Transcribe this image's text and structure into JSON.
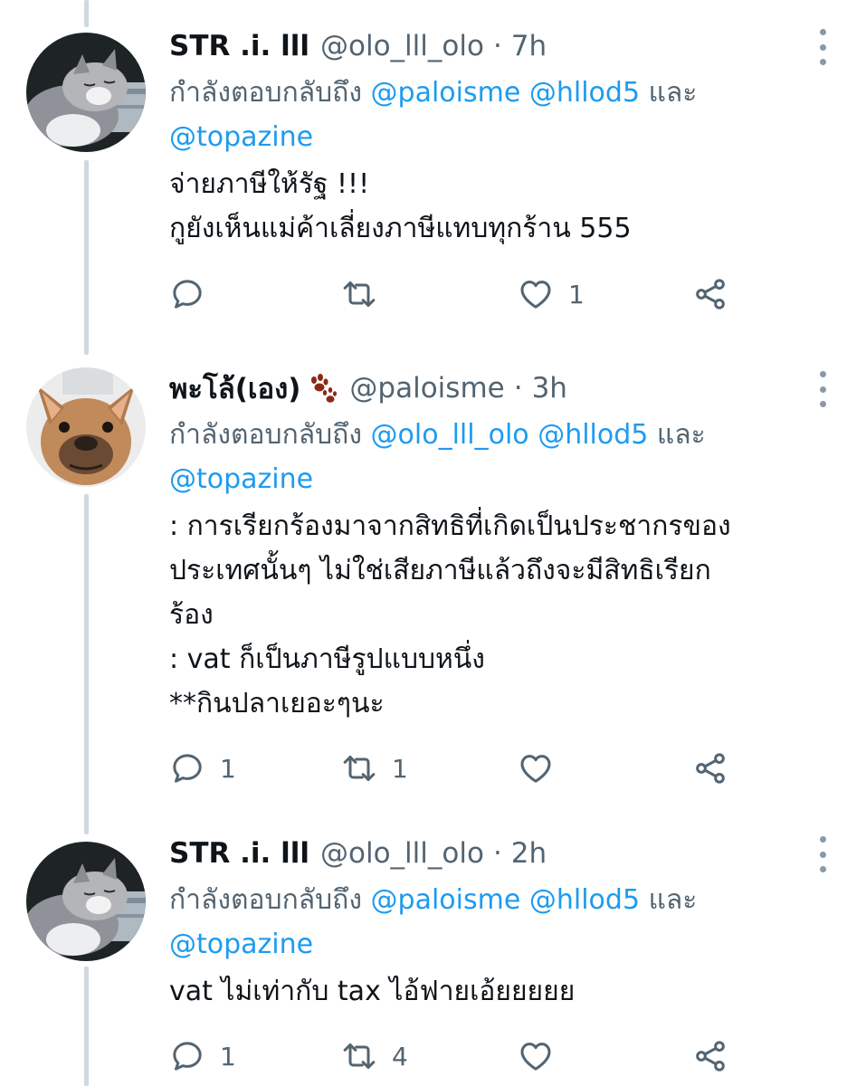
{
  "reply_prefix": "กำลังตอบกลับถึง",
  "and_word": "และ",
  "tweets": [
    {
      "name": "STR .i. lll",
      "handle": "@olo_lll_olo",
      "time": "7h",
      "mentions": [
        "@paloisme",
        "@hllod5",
        "@topazine"
      ],
      "lines": [
        "จ่ายภาษีให้รัฐ !!!",
        "กูยังเห็นแม่ค้าเลี่ยงภาษีแทบทุกร้าน 555"
      ],
      "replies": "",
      "retweets": "",
      "likes": "1"
    },
    {
      "name": "พะโล้(เอง)",
      "name_emoji": "paw-prints-icon",
      "handle": "@paloisme",
      "time": "3h",
      "mentions": [
        "@olo_lll_olo",
        "@hllod5",
        "@topazine"
      ],
      "lines": [
        ": การเรียกร้องมาจากสิทธิที่เกิดเป็นประชากรของ",
        "ประเทศนั้นๆ ไม่ใช่เสียภาษีแล้วถึงจะมีสิทธิเรียก",
        "ร้อง",
        ": vat ก็เป็นภาษีรูปแบบหนึ่ง",
        "**กินปลาเยอะๆนะ"
      ],
      "replies": "1",
      "retweets": "1",
      "likes": ""
    },
    {
      "name": "STR .i. lll",
      "handle": "@olo_lll_olo",
      "time": "2h",
      "mentions": [
        "@paloisme",
        "@hllod5",
        "@topazine"
      ],
      "lines": [
        "vat ไม่เท่ากับ tax ไอ้ฟายเอ้ยยยยย"
      ],
      "replies": "1",
      "retweets": "4",
      "likes": ""
    }
  ],
  "colors": {
    "link": "#1d9bf0",
    "secondary_text": "#536471",
    "thread_line": "#cfd9de",
    "icon": "#536471"
  }
}
